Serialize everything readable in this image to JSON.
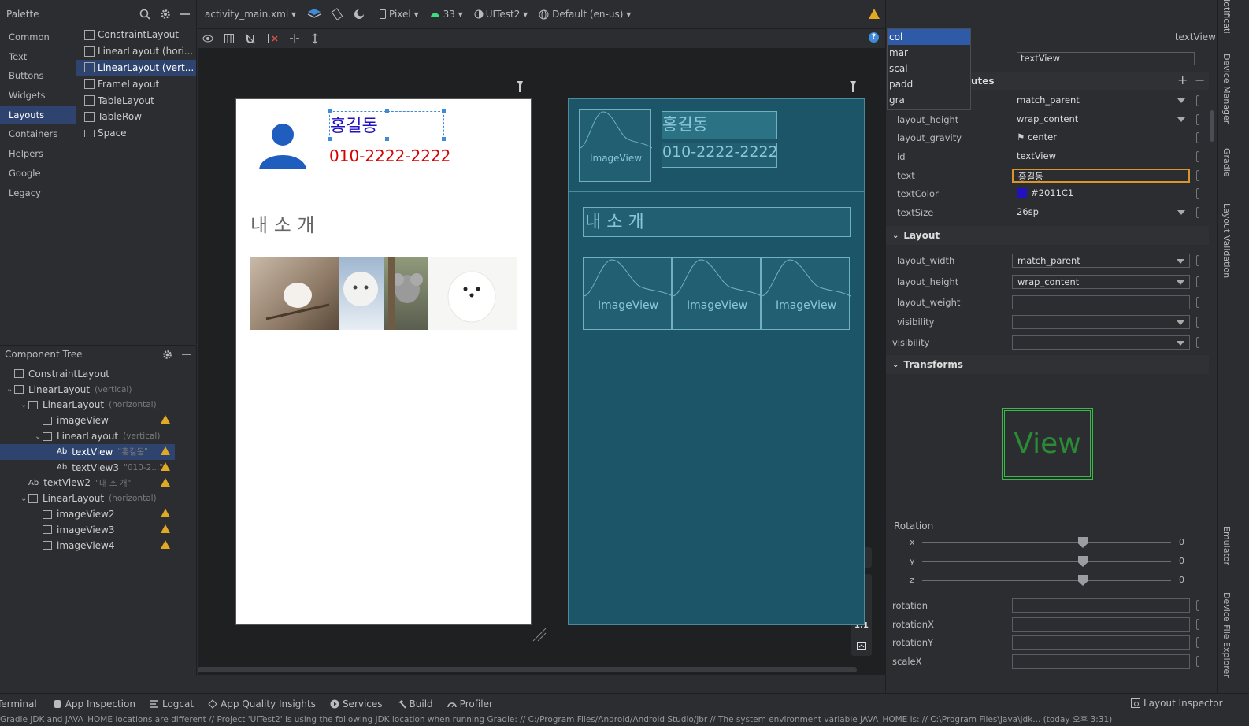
{
  "palette": {
    "title": "Palette",
    "categories": [
      "Common",
      "Text",
      "Buttons",
      "Widgets",
      "Layouts",
      "Containers",
      "Helpers",
      "Google",
      "Legacy"
    ],
    "items": [
      "ConstraintLayout",
      "LinearLayout (hori...",
      "LinearLayout (vert...",
      "FrameLayout",
      "TableLayout",
      "TableRow",
      "Space"
    ]
  },
  "tree": {
    "title": "Component Tree",
    "rows": [
      {
        "label": "ConstraintLayout",
        "sub": ""
      },
      {
        "label": "LinearLayout",
        "sub": "(vertical)"
      },
      {
        "label": "LinearLayout",
        "sub": "(horizontal)"
      },
      {
        "label": "imageView",
        "sub": ""
      },
      {
        "label": "LinearLayout",
        "sub": "(vertical)"
      },
      {
        "label": "textView",
        "sub": "\"홍길동\""
      },
      {
        "label": "textView3",
        "sub": "\"010-2...\""
      },
      {
        "label": "textView2",
        "sub": "\"내 소 개\""
      },
      {
        "label": "LinearLayout",
        "sub": "(horizontal)"
      },
      {
        "label": "imageView2",
        "sub": ""
      },
      {
        "label": "imageView3",
        "sub": ""
      },
      {
        "label": "imageView4",
        "sub": ""
      }
    ]
  },
  "toolbar": {
    "file": "activity_main.xml",
    "device": "Pixel",
    "api": "33",
    "theme": "UITest2",
    "locale": "Default (en-us)"
  },
  "search": {
    "value": ""
  },
  "popup": [
    "col",
    "mar",
    "scal",
    "padd",
    "gra"
  ],
  "design": {
    "name": "홍길동",
    "phone": "010-2222-2222",
    "intro": "내 소 개"
  },
  "blueprint": {
    "imageview": "ImageView",
    "name": "홍길동",
    "phone": "010-2222-2222",
    "intro": "내 소 개"
  },
  "attributes": {
    "selected": "textView",
    "id_field": "textView",
    "section_declared_partial": "utes",
    "declared": [
      {
        "label": "",
        "value": "match_parent",
        "dd": true
      },
      {
        "label": "layout_height",
        "value": "wrap_content",
        "dd": true
      },
      {
        "label": "layout_gravity",
        "value": "center",
        "dd": false
      },
      {
        "label": "id",
        "value": "textView",
        "dd": false
      },
      {
        "label": "text",
        "value": "홍길동",
        "dd": false
      },
      {
        "label": "textColor",
        "value": "#2011C1",
        "dd": false
      },
      {
        "label": "textSize",
        "value": "26sp",
        "dd": true
      }
    ],
    "layout_title": "Layout",
    "layout": [
      {
        "label": "layout_width",
        "value": "match_parent",
        "dd": true
      },
      {
        "label": "layout_height",
        "value": "wrap_content",
        "dd": true
      },
      {
        "label": "layout_weight",
        "value": "",
        "dd": false
      },
      {
        "label": "visibility",
        "value": "",
        "dd": true
      },
      {
        "label": "visibility",
        "value": "",
        "dd": true
      }
    ],
    "transforms_title": "Transforms",
    "preview": "View",
    "rotation_title": "Rotation",
    "rotation_axes": [
      {
        "axis": "x",
        "value": "0"
      },
      {
        "axis": "y",
        "value": "0"
      },
      {
        "axis": "z",
        "value": "0"
      }
    ],
    "extra": [
      "rotation",
      "rotationX",
      "rotationY",
      "scaleX"
    ]
  },
  "right_strip": [
    "Notifications",
    "Device Manager",
    "Gradle",
    "Layout Validation",
    "Emulator",
    "Device File Explorer"
  ],
  "bottom_tools": [
    "Terminal",
    "App Inspection",
    "Logcat",
    "App Quality Insights",
    "Services",
    "Build",
    "Profiler"
  ],
  "layout_inspector": "Layout Inspector",
  "status": "Gradle JDK and JAVA_HOME locations are different  // Project 'UITest2' is using the following JDK location when running Gradle: // C:/Program Files/Android/Android Studio/jbr // The system environment variable JAVA_HOME is: // C:\\Program Files\\Java\\jdk...  (today 오후 3:31)",
  "colors": {
    "text_color": "#2011C1",
    "name_blue": "#2011C1",
    "phone_red": "#d80000"
  }
}
